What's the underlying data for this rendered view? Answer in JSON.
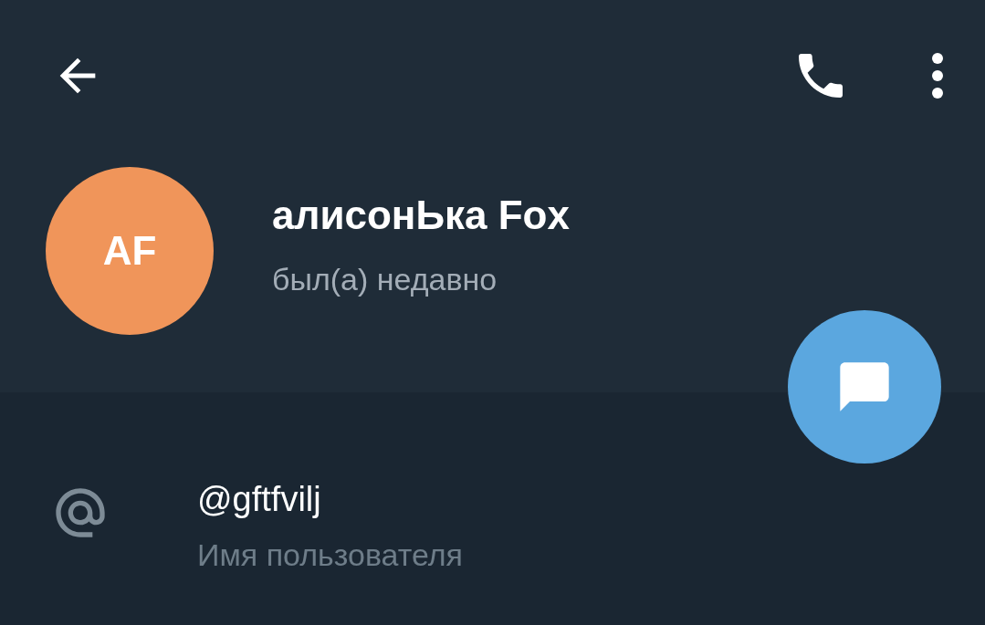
{
  "profile": {
    "initials": "AF",
    "name": "алисонЬка Fox",
    "status": "был(а) недавно"
  },
  "info": [
    {
      "kind": "username",
      "value": "@gftfvilj",
      "label": "Имя пользователя"
    }
  ]
}
